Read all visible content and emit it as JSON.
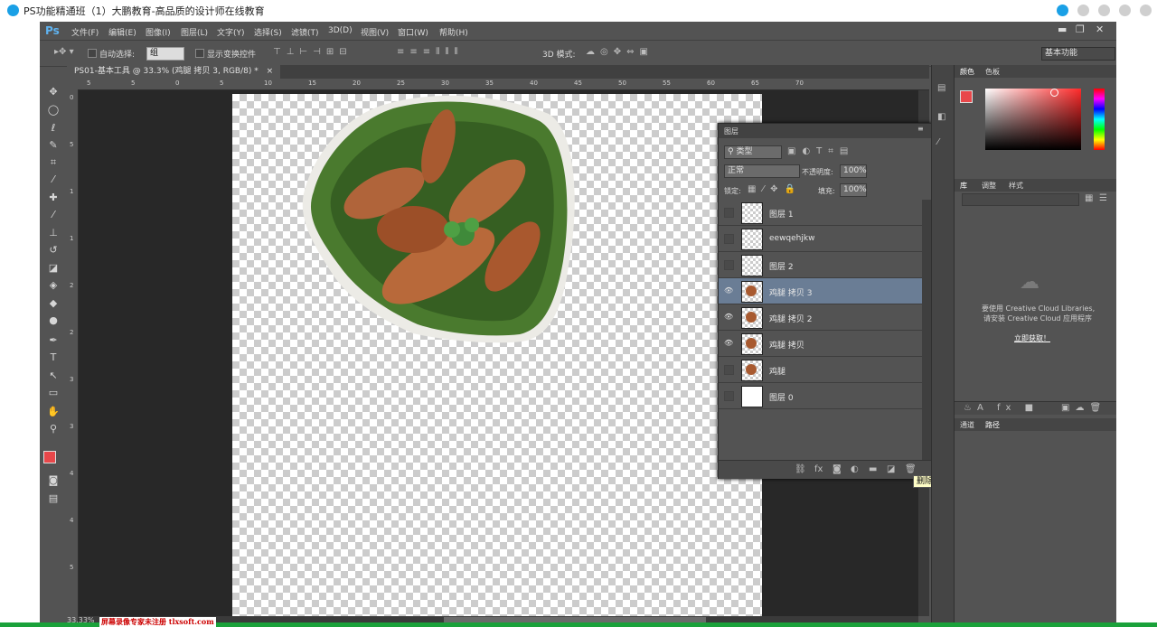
{
  "player": {
    "title": "PS功能精通班（1）大鹏教育-高品质的设计师在线教育"
  },
  "menubar": {
    "logo": "Ps",
    "items": [
      "文件(F)",
      "编辑(E)",
      "图像(I)",
      "图层(L)",
      "文字(Y)",
      "选择(S)",
      "滤镜(T)",
      "3D(D)",
      "视图(V)",
      "窗口(W)",
      "帮助(H)"
    ]
  },
  "options": {
    "auto_select_label": "自动选择:",
    "auto_select_value": "组",
    "show_transform_label": "显示变换控件",
    "mode_3d_label": "3D 模式:",
    "workspace": "基本功能"
  },
  "document": {
    "tab_title": "PS01-基本工具 @ 33.3% (鸡腿 拷贝 3, RGB/8) *",
    "zoom": "33.33%"
  },
  "ruler": {
    "top_ticks": [
      "5",
      "5",
      "0",
      "5",
      "10",
      "15",
      "20",
      "25",
      "30",
      "35",
      "40",
      "45",
      "50",
      "55",
      "60",
      "65",
      "70"
    ],
    "left_ticks": [
      "0",
      "5",
      "1",
      "1",
      "2",
      "2",
      "3",
      "3",
      "4",
      "4",
      "5"
    ]
  },
  "layers_panel": {
    "title": "图层",
    "filter_type": "类型",
    "blend_mode": "正常",
    "opacity_label": "不透明度:",
    "opacity_value": "100%",
    "lock_label": "锁定:",
    "fill_label": "填充:",
    "fill_value": "100%",
    "layers": [
      {
        "name": "图层 1",
        "visible": false,
        "selected": false,
        "thumb": "transparent"
      },
      {
        "name": "eewqehjkw",
        "visible": false,
        "selected": false,
        "thumb": "transparent"
      },
      {
        "name": "图层 2",
        "visible": false,
        "selected": false,
        "thumb": "transparent"
      },
      {
        "name": "鸡腿 拷贝 3",
        "visible": true,
        "selected": true,
        "thumb": "food"
      },
      {
        "name": "鸡腿 拷贝 2",
        "visible": true,
        "selected": false,
        "thumb": "food"
      },
      {
        "name": "鸡腿 拷贝",
        "visible": true,
        "selected": false,
        "thumb": "food"
      },
      {
        "name": "鸡腿",
        "visible": false,
        "selected": false,
        "thumb": "food"
      },
      {
        "name": "图层 0",
        "visible": false,
        "selected": false,
        "thumb": "white"
      }
    ],
    "tooltip": "删除图层"
  },
  "color_panel": {
    "tab_color": "颜色",
    "tab_swatches": "色板",
    "foreground": "#e8474a",
    "background": "#1f55a8"
  },
  "library_panel": {
    "tab_library": "库",
    "tab_adjust": "调整",
    "tab_style": "样式",
    "message_line1": "要使用 Creative Cloud Libraries,",
    "message_line2": "请安装 Creative Cloud 应用程序",
    "link": "立即获取！"
  },
  "paths_panel": {
    "tab_channels": "通道",
    "tab_paths": "路径"
  },
  "watermark": "屏幕录像专家未注册 tlxsoft.com"
}
